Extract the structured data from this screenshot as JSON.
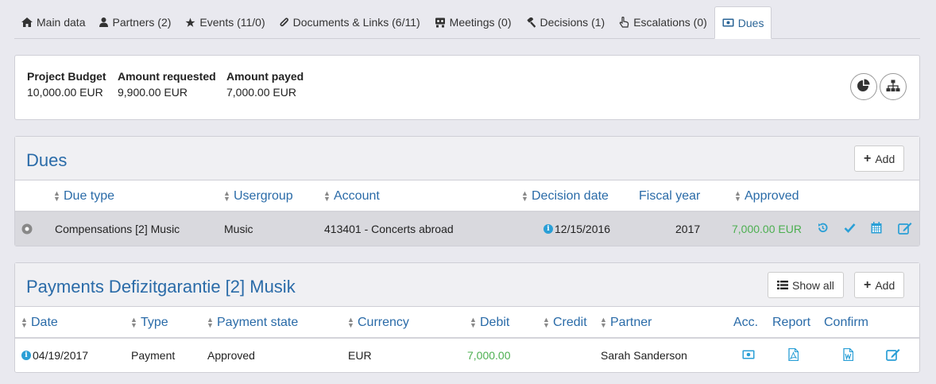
{
  "tabs": [
    {
      "label": "Main data",
      "icon": "home-icon"
    },
    {
      "label": "Partners (2)",
      "icon": "user-icon"
    },
    {
      "label": "Events (11/0)",
      "icon": "star-icon"
    },
    {
      "label": "Documents & Links (6/11)",
      "icon": "paperclip-icon"
    },
    {
      "label": "Meetings (0)",
      "icon": "meeting-icon"
    },
    {
      "label": "Decisions (1)",
      "icon": "gavel-icon"
    },
    {
      "label": "Escalations (0)",
      "icon": "hand-pointer-icon"
    },
    {
      "label": "Dues",
      "icon": "money-icon",
      "active": true
    }
  ],
  "budget": {
    "project_budget_label": "Project Budget",
    "project_budget_value": "10,000.00 EUR",
    "requested_label": "Amount requested",
    "requested_value": "9,900.00 EUR",
    "payed_label": "Amount payed",
    "payed_value": "7,000.00 EUR"
  },
  "dues": {
    "title": "Dues",
    "add_label": "Add",
    "columns": {
      "due_type": "Due type",
      "usergroup": "Usergroup",
      "account": "Account",
      "decision_date": "Decision date",
      "fiscal_year": "Fiscal year",
      "approved": "Approved"
    },
    "row": {
      "due_type": "Compensations [2] Music",
      "usergroup": "Music",
      "account": "413401 - Concerts abroad",
      "decision_date": "12/15/2016",
      "fiscal_year": "2017",
      "approved": "7,000.00 EUR"
    }
  },
  "payments": {
    "title": "Payments Defizitgarantie [2] Musik",
    "show_all_label": "Show all",
    "add_label": "Add",
    "columns": {
      "date": "Date",
      "type": "Type",
      "state": "Payment state",
      "currency": "Currency",
      "debit": "Debit",
      "credit": "Credit",
      "partner": "Partner",
      "acc": "Acc.",
      "report": "Report",
      "confirm": "Confirm"
    },
    "row": {
      "date": "04/19/2017",
      "type": "Payment",
      "state": "Approved",
      "currency": "EUR",
      "debit": "7,000.00",
      "credit": "",
      "partner": "Sarah Sanderson"
    }
  },
  "colors": {
    "accent": "#2a6ba8",
    "action": "#2a9fd6",
    "amount": "#4caf50"
  }
}
